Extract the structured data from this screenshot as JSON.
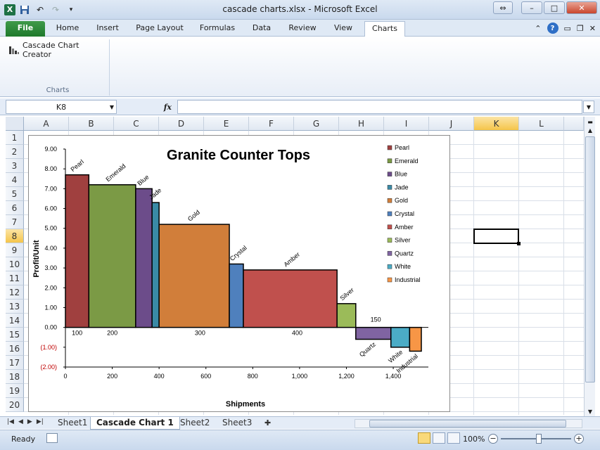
{
  "window": {
    "title": "cascade charts.xlsx  -  Microsoft Excel"
  },
  "ribbon": {
    "tabs": [
      "File",
      "Home",
      "Insert",
      "Page Layout",
      "Formulas",
      "Data",
      "Review",
      "View",
      "Charts"
    ],
    "active_tab": "Charts",
    "button_label": "Cascade Chart Creator",
    "group_label": "Charts",
    "help_label": "?"
  },
  "formula_bar": {
    "name_box": "K8",
    "fx_label": "fx",
    "value": ""
  },
  "grid": {
    "columns": [
      "A",
      "B",
      "C",
      "D",
      "E",
      "F",
      "G",
      "H",
      "I",
      "J",
      "K",
      "L"
    ],
    "rows": [
      "1",
      "2",
      "3",
      "4",
      "5",
      "6",
      "7",
      "8",
      "9",
      "10",
      "11",
      "12",
      "13",
      "14",
      "15",
      "16",
      "17",
      "18",
      "19",
      "20"
    ],
    "selected_cell": "K8"
  },
  "sheets": {
    "tabs": [
      "Sheet1",
      "Cascade Chart 1",
      "Sheet2",
      "Sheet3"
    ],
    "active": "Cascade Chart 1"
  },
  "status": {
    "ready": "Ready",
    "zoom": "100%"
  },
  "chart_data": {
    "type": "bar",
    "title": "Granite Counter Tops",
    "xlabel": "Shipments",
    "ylabel": "Profit/Unit",
    "xlim": [
      0,
      1550
    ],
    "ylim": [
      -2.0,
      9.0
    ],
    "y_ticks": [
      "9.00",
      "8.00",
      "7.00",
      "6.00",
      "5.00",
      "4.00",
      "3.00",
      "2.00",
      "1.00",
      "0.00",
      "(1.00)",
      "(2.00)"
    ],
    "x_ticks": [
      "0",
      "200",
      "400",
      "600",
      "800",
      "1,000",
      "1,200",
      "1,400"
    ],
    "negative_color": "#c00000",
    "legend_position": "right",
    "width_labels": [
      {
        "text": "100",
        "x": 50
      },
      {
        "text": "200",
        "x": 200
      },
      {
        "text": "300",
        "x": 575
      },
      {
        "text": "400",
        "x": 990
      },
      {
        "text": "150",
        "x": 1325
      }
    ],
    "series": [
      {
        "name": "Pearl",
        "shipments": 100,
        "profit": 7.7,
        "color": "#a0403f"
      },
      {
        "name": "Emerald",
        "shipments": 200,
        "profit": 7.2,
        "color": "#7b9a45"
      },
      {
        "name": "Blue",
        "shipments": 70,
        "profit": 7.0,
        "color": "#6c4c8a"
      },
      {
        "name": "Jade",
        "shipments": 30,
        "profit": 6.3,
        "color": "#3a8aa6"
      },
      {
        "name": "Gold",
        "shipments": 300,
        "profit": 5.2,
        "color": "#d17e3a"
      },
      {
        "name": "Crystal",
        "shipments": 60,
        "profit": 3.2,
        "color": "#4f80bd"
      },
      {
        "name": "Amber",
        "shipments": 400,
        "profit": 2.9,
        "color": "#c0504d"
      },
      {
        "name": "Silver",
        "shipments": 80,
        "profit": 1.2,
        "color": "#9bbb59"
      },
      {
        "name": "Quartz",
        "shipments": 150,
        "profit": -0.6,
        "color": "#8064a2"
      },
      {
        "name": "White",
        "shipments": 80,
        "profit": -1.0,
        "color": "#4bacc6"
      },
      {
        "name": "Industrial",
        "shipments": 50,
        "profit": -1.2,
        "color": "#f79646"
      }
    ]
  }
}
